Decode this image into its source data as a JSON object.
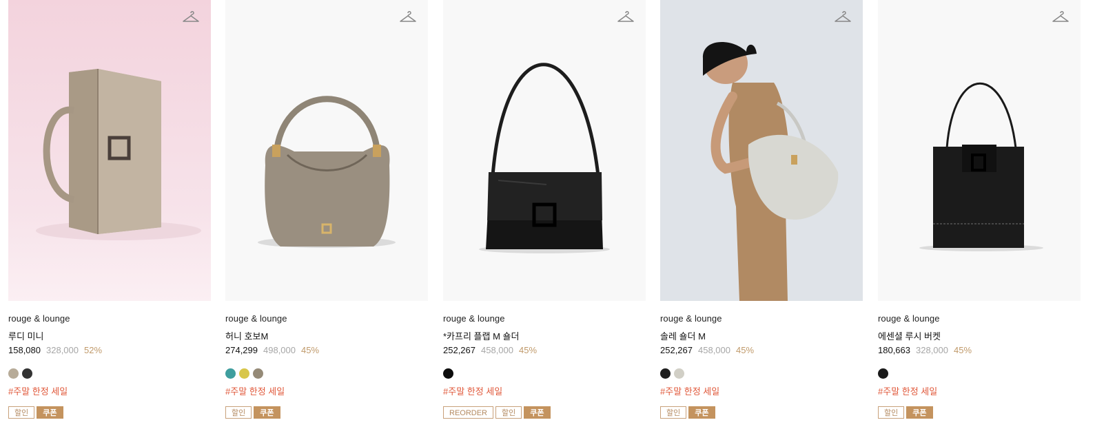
{
  "products": [
    {
      "brand": "rouge & lounge",
      "name": "루디 미니",
      "sale_price": "158,080",
      "original_price": "328,000",
      "discount": "52%",
      "swatches": [
        "#b7ab98",
        "#333333"
      ],
      "tag": "#주말 한정 세일",
      "badges": [
        {
          "label": "할인",
          "style": "outline"
        },
        {
          "label": "쿠폰",
          "style": "filled"
        }
      ],
      "image_bg": "#f5dce3",
      "image_desc_icon": "vanity-bag-image"
    },
    {
      "brand": "rouge & lounge",
      "name": "허니 호보M",
      "sale_price": "274,299",
      "original_price": "498,000",
      "discount": "45%",
      "swatches": [
        "#3f9e9e",
        "#d8c64a",
        "#958a77"
      ],
      "tag": "#주말 한정 세일",
      "badges": [
        {
          "label": "할인",
          "style": "outline"
        },
        {
          "label": "쿠폰",
          "style": "filled"
        }
      ],
      "image_bg": "#f8f8f8",
      "image_desc_icon": "hobo-bag-image"
    },
    {
      "brand": "rouge & lounge",
      "name": "*카프리 플랩 M 숄더",
      "sale_price": "252,267",
      "original_price": "458,000",
      "discount": "45%",
      "swatches": [
        "#0d0d0d"
      ],
      "tag": "#주말 한정 세일",
      "badges": [
        {
          "label": "REORDER",
          "style": "outline"
        },
        {
          "label": "할인",
          "style": "outline"
        },
        {
          "label": "쿠폰",
          "style": "filled"
        }
      ],
      "image_bg": "#f8f8f8",
      "image_desc_icon": "flap-shoulder-bag-image"
    },
    {
      "brand": "rouge & lounge",
      "name": "솔레 숄더 M",
      "sale_price": "252,267",
      "original_price": "458,000",
      "discount": "45%",
      "swatches": [
        "#1f1f1f",
        "#d1cfc6"
      ],
      "tag": "#주말 한정 세일",
      "badges": [
        {
          "label": "할인",
          "style": "outline"
        },
        {
          "label": "쿠폰",
          "style": "filled"
        }
      ],
      "image_bg": "#dfe3e7",
      "image_desc_icon": "model-shoulder-bag-image"
    },
    {
      "brand": "rouge & lounge",
      "name": "에센셜 루시 버켓",
      "sale_price": "180,663",
      "original_price": "328,000",
      "discount": "45%",
      "swatches": [
        "#1a1a1a"
      ],
      "tag": "#주말 한정 세일",
      "badges": [
        {
          "label": "할인",
          "style": "outline"
        },
        {
          "label": "쿠폰",
          "style": "filled"
        }
      ],
      "image_bg": "#f8f8f8",
      "image_desc_icon": "bucket-bag-image"
    }
  ],
  "colors": {
    "discount_pct": "#c09a6b",
    "tag_text": "#e0583a",
    "badge_fill": "#c4935e",
    "badge_outline": "#c8a07a"
  }
}
